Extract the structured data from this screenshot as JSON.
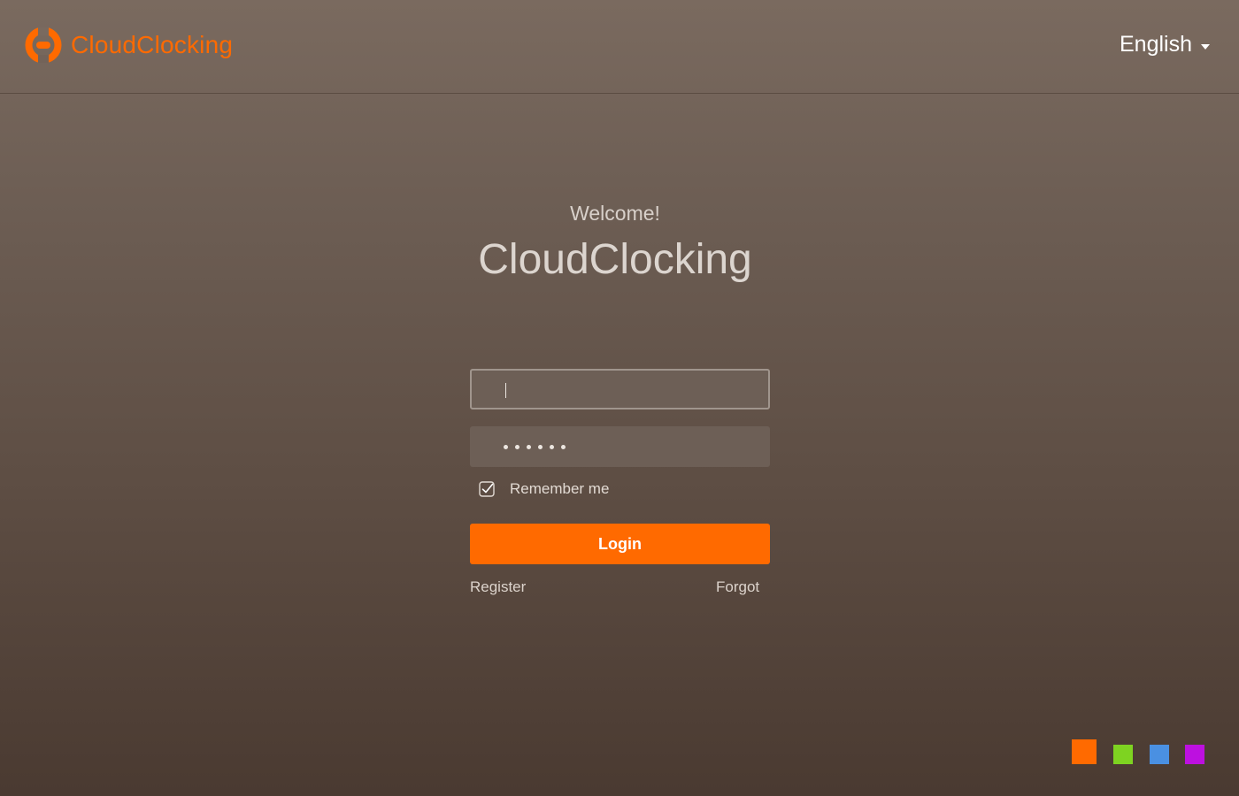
{
  "header": {
    "brand": "CloudClocking",
    "logo_icon": "brand-logo-icon",
    "language": "English",
    "language_caret_icon": "caret-down-icon"
  },
  "login": {
    "welcome": "Welcome!",
    "title": "CloudClocking",
    "username": {
      "value": "",
      "placeholder": ""
    },
    "password": {
      "masked_length": 6
    },
    "remember_label": "Remember me",
    "remember_checked": true,
    "login_label": "Login",
    "register_label": "Register",
    "forgot_label": "Forgot"
  },
  "theme_swatches": [
    {
      "name": "orange",
      "color": "#ff6a00",
      "selected": true
    },
    {
      "name": "green",
      "color": "#7ed321",
      "selected": false
    },
    {
      "name": "blue",
      "color": "#4a90e2",
      "selected": false
    },
    {
      "name": "purple",
      "color": "#bd10e0",
      "selected": false
    }
  ],
  "colors": {
    "accent": "#ff6a00"
  }
}
